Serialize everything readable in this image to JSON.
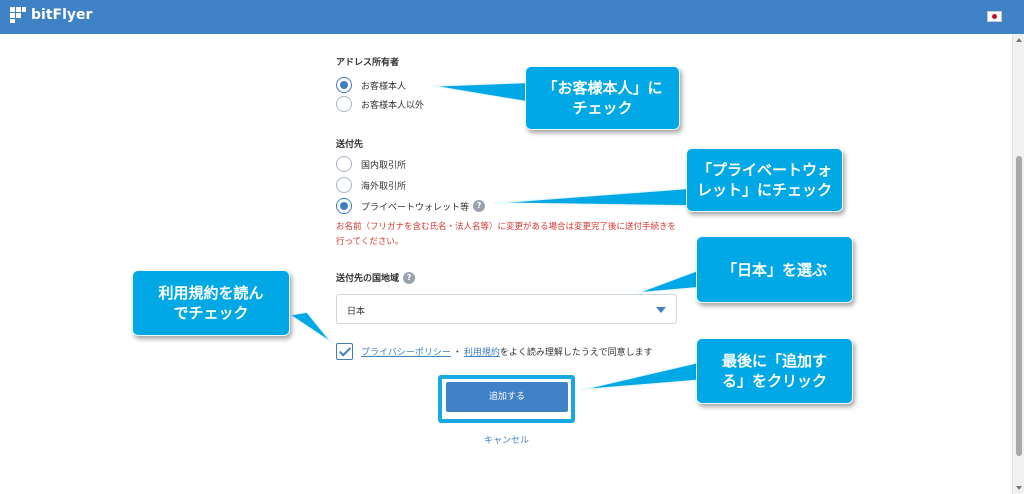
{
  "header": {
    "brand": "bitFlyer",
    "language_flag": "japan-flag-icon"
  },
  "form": {
    "address_owner": {
      "label": "アドレス所有者",
      "options": [
        "お客様本人",
        "お客様本人以外"
      ],
      "selected": "お客様本人"
    },
    "destination": {
      "label": "送付先",
      "options": [
        "国内取引所",
        "海外取引所",
        "プライベートウォレット等"
      ],
      "selected": "プライベートウォレット等",
      "help": "?",
      "notice": "お名前（フリガナを含む氏名・法人名等）に変更がある場合は変更完了後に送付手続きを行ってください。"
    },
    "country": {
      "label": "送付先の国地域",
      "help": "?",
      "value": "日本"
    },
    "agreement": {
      "checked": true,
      "privacy_link": "プライバシーポリシー",
      "separator": "・",
      "terms_link": "利用規約",
      "text": "をよく読み理解したうえで同意します"
    },
    "add_button": "追加する",
    "cancel_link": "キャンセル"
  },
  "callouts": {
    "owner": [
      "「お客様本人」に",
      "チェック"
    ],
    "wallet": [
      "「プライベートウォ",
      "レット」にチェック"
    ],
    "country": [
      "「日本」を選ぶ"
    ],
    "terms": [
      "利用規約を読ん",
      "でチェック"
    ],
    "add": [
      "最後に「追加す",
      "る」をクリック"
    ]
  },
  "colors": {
    "header": "#3f82c6",
    "callout": "#00a8e6",
    "notice": "#d9342b"
  }
}
